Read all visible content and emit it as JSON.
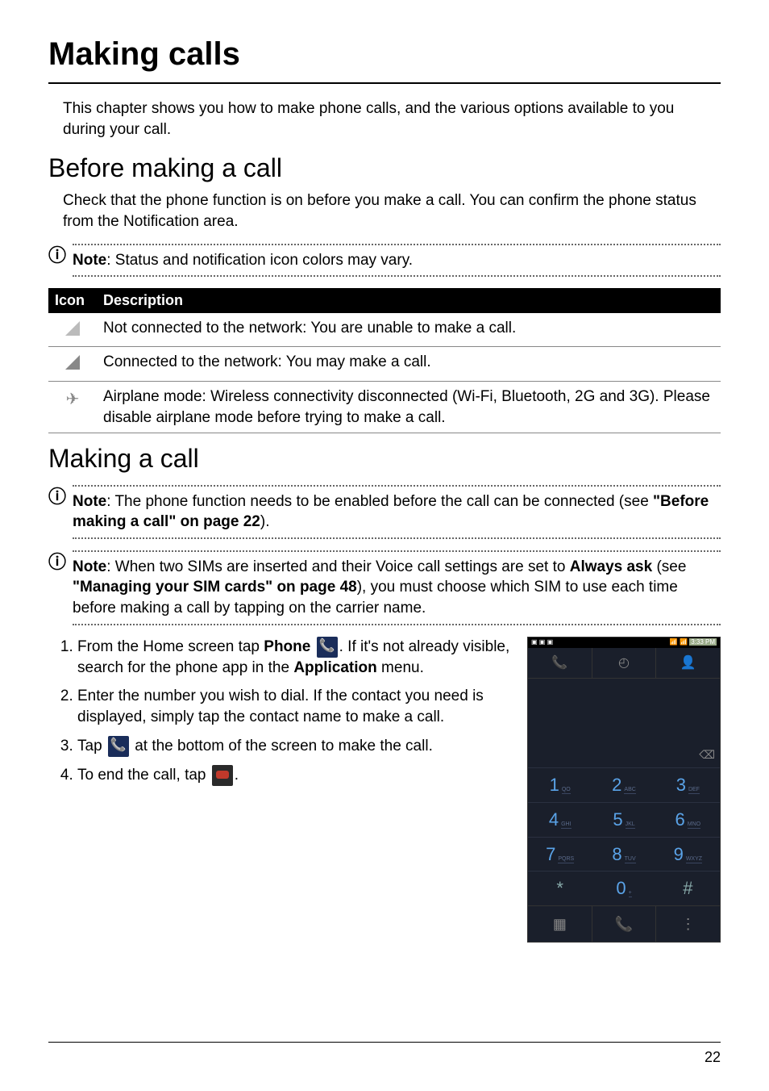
{
  "page_number": "22",
  "chapter_title": "Making calls",
  "intro": "This chapter shows you how to make phone calls, and the various options available to you during your call.",
  "section_before": {
    "heading": "Before making a call",
    "para": "Check that the phone function is on before you make a call. You can confirm the phone status from the Notification area.",
    "note_prefix": "Note",
    "note_text": ": Status and notification icon colors may vary."
  },
  "table": {
    "headers": {
      "icon": "Icon",
      "desc": "Description"
    },
    "rows": [
      {
        "icon_name": "signal-empty-icon",
        "desc": "Not connected to the network: You are unable to make a call."
      },
      {
        "icon_name": "signal-full-icon",
        "desc": "Connected to the network: You may make a call."
      },
      {
        "icon_name": "airplane-icon",
        "desc": "Airplane mode: Wireless connectivity disconnected (Wi-Fi, Bluetooth, 2G and 3G). Please disable airplane mode before trying to make a call."
      }
    ]
  },
  "section_making": {
    "heading": "Making a call",
    "note1_prefix": "Note",
    "note1_text": ": The phone function needs to be enabled before the call can be connected (see ",
    "note1_bold": "\"Before making a call\" on page 22",
    "note1_after": ").",
    "note2_prefix": "Note",
    "note2_text1": ": When two SIMs are inserted and their Voice call settings are set to ",
    "note2_bold1": "Always ask",
    "note2_mid": " (see ",
    "note2_bold2": "\"Managing your SIM cards\" on page 48",
    "note2_text2": "), you must choose which SIM to use each time before making a call by tapping on the carrier name.",
    "steps": [
      {
        "pre": "From the Home screen tap ",
        "bold1": "Phone",
        "mid": ". If it's not already visible, search for the phone app in the ",
        "bold2": "Application",
        "post": " menu."
      },
      {
        "text": "Enter the number you wish to dial. If the contact you need is displayed, simply tap the contact name to make a call."
      },
      {
        "pre": "Tap ",
        "post": " at the bottom of the screen to make the call."
      },
      {
        "pre": "To end the call, tap ",
        "post": "."
      }
    ]
  },
  "dialer": {
    "status_time": "3:33 PM",
    "keys": [
      {
        "n": "1",
        "l": "QO"
      },
      {
        "n": "2",
        "l": "ABC"
      },
      {
        "n": "3",
        "l": "DEF"
      },
      {
        "n": "4",
        "l": "GHI"
      },
      {
        "n": "5",
        "l": "JKL"
      },
      {
        "n": "6",
        "l": "MNO"
      },
      {
        "n": "7",
        "l": "PQRS"
      },
      {
        "n": "8",
        "l": "TUV"
      },
      {
        "n": "9",
        "l": "WXYZ"
      },
      {
        "n": "*",
        "l": ""
      },
      {
        "n": "0",
        "l": "+"
      },
      {
        "n": "#",
        "l": ""
      }
    ]
  }
}
